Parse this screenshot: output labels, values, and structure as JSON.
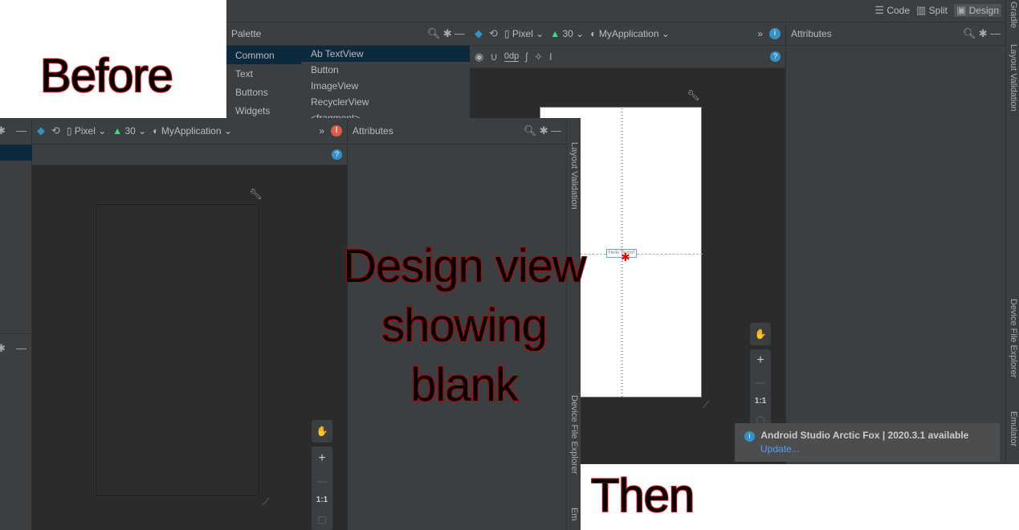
{
  "overlay": {
    "before": "Before",
    "middle": [
      "Design view",
      "showing",
      "blank"
    ],
    "then": "Then"
  },
  "then_window": {
    "view_modes": [
      {
        "label": "Code",
        "icon": "code-icon"
      },
      {
        "label": "Split",
        "icon": "split-icon"
      },
      {
        "label": "Design",
        "icon": "design-icon",
        "selected": true
      }
    ],
    "palette": {
      "title": "Palette",
      "categories": [
        "Common",
        "Text",
        "Buttons",
        "Widgets"
      ],
      "items": [
        "Ab TextView",
        "Button",
        "ImageView",
        "RecyclerView",
        "<fragment>"
      ]
    },
    "toolbar": {
      "device": "Pixel",
      "api": "30",
      "theme": "MyApplication",
      "more": "»",
      "status": "info"
    },
    "toolbar2": {
      "margin": "0dp"
    },
    "attributes_title": "Attributes",
    "side_tabs": [
      "Gradle",
      "Layout Validation",
      "Device File Explorer",
      "Emulator"
    ],
    "canvas_text": "Hello World!",
    "zoom": {
      "plus": "+",
      "minus": "—",
      "one_to_one": "1:1"
    },
    "notification": {
      "title": "Android Studio Arctic Fox | 2020.3.1 available",
      "link": "Update..."
    }
  },
  "before_window": {
    "toolbar": {
      "device": "Pixel",
      "api": "30",
      "theme": "MyApplication",
      "more": "»",
      "status": "error"
    },
    "attributes_title": "Attributes",
    "side_tabs": [
      "Layout Validation",
      "Device File Explorer",
      "Em"
    ],
    "zoom": {
      "plus": "+",
      "minus": "—",
      "one_to_one": "1:1"
    }
  },
  "colors": {
    "accent_blue": "#3592c4",
    "error_red": "#e05a4a",
    "link": "#589df6",
    "android_green": "#3ddc84"
  }
}
